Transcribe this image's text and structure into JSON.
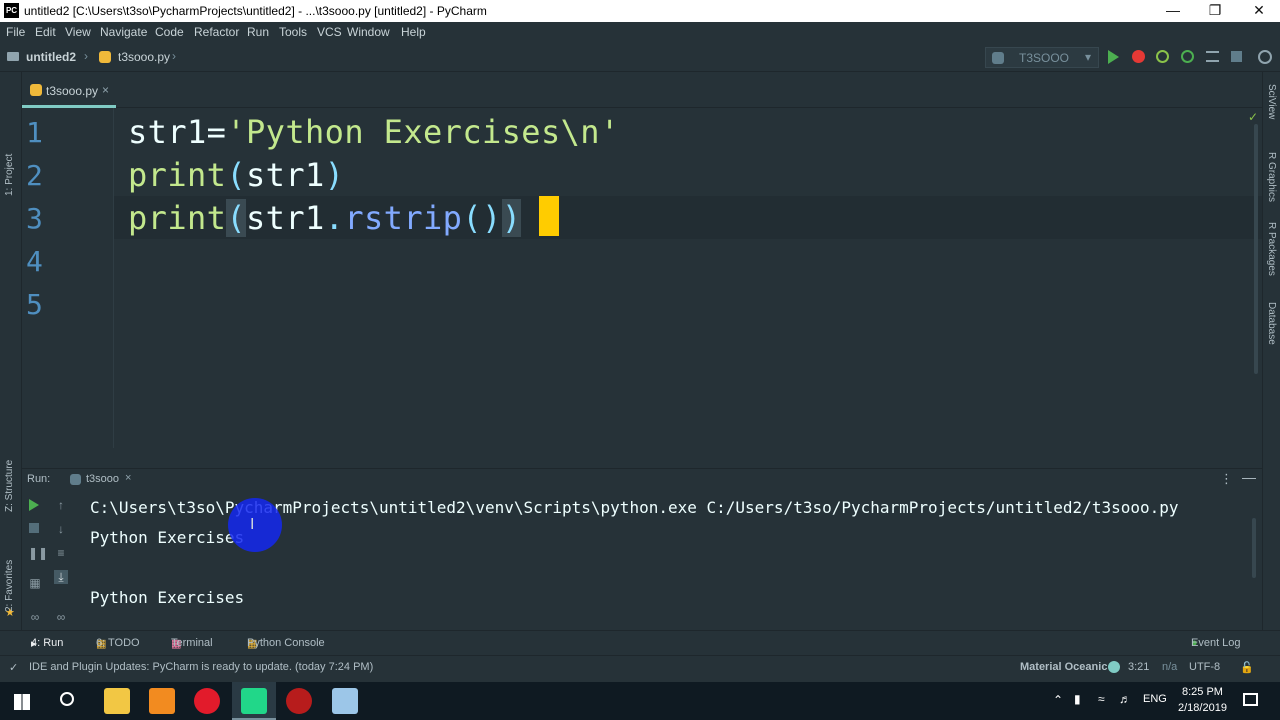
{
  "window": {
    "title": "untitled2 [C:\\Users\\t3so\\PycharmProjects\\untitled2] - ...\\t3sooo.py [untitled2] - PyCharm",
    "app_icon_label": "PC"
  },
  "menu": [
    "File",
    "Edit",
    "View",
    "Navigate",
    "Code",
    "Refactor",
    "Run",
    "Tools",
    "VCS",
    "Window",
    "Help"
  ],
  "breadcrumb": {
    "project": "untitled2",
    "file": "t3sooo.py"
  },
  "run_config": {
    "selected": "T3SOOO"
  },
  "left_strip": {
    "project": "1: Project",
    "structure": "Z: Structure",
    "favorites": "2: Favorites"
  },
  "right_strip": {
    "sciview": "SciView",
    "rgraphics": "R Graphics",
    "rpackages": "R Packages",
    "database": "Database"
  },
  "editor": {
    "tab_label": "t3sooo.py",
    "line_numbers": [
      "1",
      "2",
      "3",
      "4",
      "5"
    ],
    "lines": [
      {
        "t1": "str1=",
        "t2": "'Python Exercises\\n'"
      },
      {
        "t1": "print",
        "t2": "(",
        "t3": "str1",
        "t4": ")"
      },
      {
        "t1": "print",
        "t2": "(",
        "t3": "str1",
        "t4": ".",
        "t5": "rstrip",
        "t6": "()",
        "t7": ")"
      }
    ]
  },
  "run": {
    "label": "Run:",
    "tab": "t3sooo",
    "output": [
      "C:\\Users\\t3so\\PycharmProjects\\untitled2\\venv\\Scripts\\python.exe C:/Users/t3so/PycharmProjects/untitled2/t3sooo.py",
      "Python Exercises",
      "",
      "Python Exercises"
    ]
  },
  "bottom_tabs": {
    "run": "4: Run",
    "todo": "6: TODO",
    "terminal": "Terminal",
    "console": "Python Console",
    "eventlog": "Event Log"
  },
  "status": {
    "message": "IDE and Plugin Updates: PyCharm is ready to update. (today 7:24 PM)",
    "theme": "Material Oceanic",
    "position": "3:21",
    "na": "n/a",
    "encoding": "UTF-8"
  },
  "taskbar": {
    "lang": "ENG",
    "time": "8:25 PM",
    "date": "2/18/2019"
  },
  "colors": {
    "accent": "#80cbc4",
    "caret": "#ffcc00",
    "bg": "#263238",
    "run_green": "#4caf50",
    "stop_red": "#e53935"
  }
}
